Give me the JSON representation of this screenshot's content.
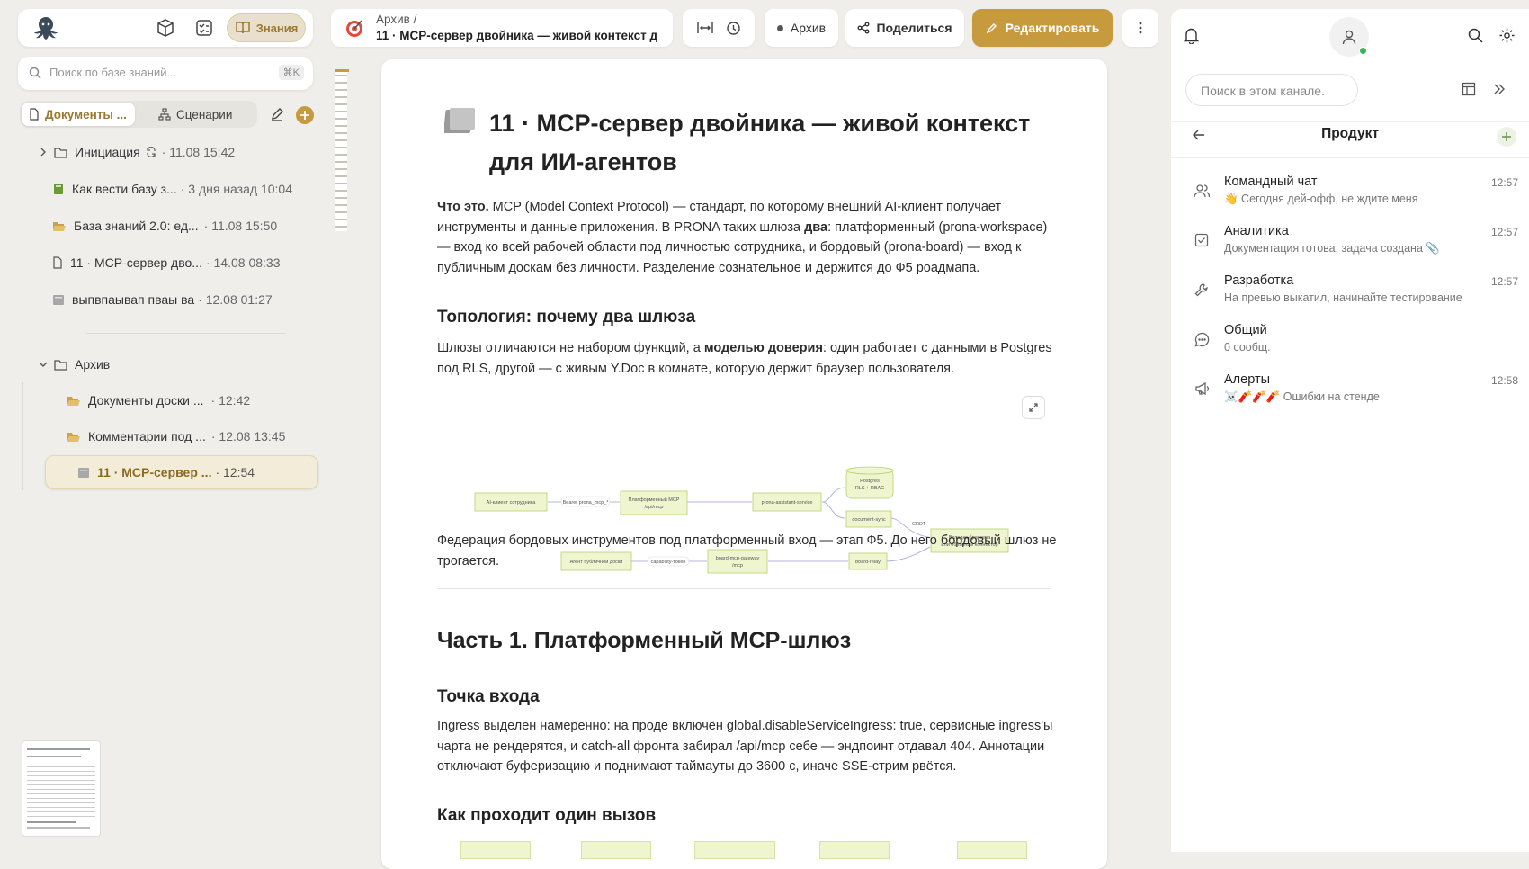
{
  "left": {
    "nav_active": "Знания",
    "search_placeholder": "Поиск по базе знаний...",
    "search_shortcut": "⌘K",
    "tab_docs": "Документы ...",
    "tab_scenarios": "Сценарии",
    "tree": [
      {
        "label": "Инициация",
        "meta": "· 11.08 15:42"
      },
      {
        "label": "Как вести базу з...",
        "meta": "· 3 дня назад 10:04"
      },
      {
        "label": "База знаний 2.0: ед...",
        "meta": "· 11.08 15:50"
      },
      {
        "label": "11 · MCP-сервер дво...",
        "meta": "· 14.08 08:33"
      },
      {
        "label": "выпвпаывап пваы ва",
        "meta": "· 12.08 01:27"
      },
      {
        "label": "Архив",
        "meta": ""
      },
      {
        "label": "Документы доски ...",
        "meta": "· 12:42"
      },
      {
        "label": "Комментарии под ...",
        "meta": "· 12.08 13:45"
      },
      {
        "label": "11 · MCP-сервер ...",
        "meta": "· 12:54"
      }
    ]
  },
  "top": {
    "breadcrumb_parent": "Архив",
    "breadcrumb_sep": "/",
    "breadcrumb_title": "11 · MCP-сервер двойника — живой контекст д",
    "status_label": "Архив",
    "share_label": "Поделиться",
    "edit_label": "Редактировать",
    "accent": "#c79a3e"
  },
  "doc": {
    "title_line1": "11 · MCP-сервер двойника — живой контекст",
    "title_line2": "для ИИ-агентов",
    "intro_bold": "Что это.",
    "intro_a": " MCP (Model Context Protocol) — стандарт, по которому внешний AI-клиент получает инструменты и данные приложения. В PRONA таких шлюза ",
    "intro_b": "два",
    "intro_c": ": платформенный (prona-workspace) — вход ко всей рабочей области под личностью сотрудника, и бордовый (prona-board) — вход к публичным доскам без личности. Разделение сознательное и держится до Ф5 роадмапа.",
    "h_topology": "Топология: почему два шлюза",
    "topo_a": "Шлюзы отличаются не набором функций, а ",
    "topo_b": "моделью доверия",
    "topo_c": ": один работает с данными в Postgres под RLS, другой — с живым Y.Doc в комнате, которую держит браузер пользователя.",
    "diagram": {
      "n_ai": "AI-клиент сотрудника",
      "e_bearer": "Bearer prona_mcp_*",
      "n_platform_1": "Платформенный MCP",
      "n_platform_2": "/api/mcp",
      "n_assistant": "prona-assistant-service",
      "n_pg_1": "Postgres",
      "n_pg_2": "RLS + RBAC",
      "n_docsync": "document-sync",
      "e_crdt": "CRDT",
      "n_tab_1": "Вкладка браузера",
      "n_tab_2": "или облачный коннектор",
      "n_pubagent": "Агент публичной доски",
      "e_cap": "capability-токен",
      "n_gateway_1": "board-mcp-gateway",
      "n_gateway_2": "/mcp",
      "n_relay": "board-relay"
    },
    "federation": "Федерация бордовых инструментов под платформенный вход — этап Ф5. До него бордовый шлюз не трогается.",
    "h_part1": "Часть 1. Платформенный MCP-шлюз",
    "h_entry": "Точка входа",
    "entry_text": "Ingress выделен намеренно: на проде включён global.disableServiceIngress: true, сервисные ingress'ы чарта не рендерятся, и catch-all фронта забирал /api/mcp себе — эндпоинт отдавал 404. Аннотации отключают буферизацию и поднимают таймауты до 3600 с, иначе SSE-стрим рвётся.",
    "h_call": "Как проходит один вызов"
  },
  "right": {
    "search_placeholder": "Поиск в этом канале.",
    "title": "Продукт",
    "channels": [
      {
        "name": "Командный чат",
        "preview": "👋 Сегодня дей-офф, не ждите меня",
        "time": "12:57",
        "icon": "users-icon"
      },
      {
        "name": "Аналитика",
        "preview": "Документация готова, задача создана 📎",
        "time": "12:57",
        "icon": "checkbox-icon"
      },
      {
        "name": "Разработка",
        "preview": "На превью выкатил, начинайте тестирование",
        "time": "12:57",
        "icon": "wrench-icon"
      },
      {
        "name": "Общий",
        "preview": "0 сообщ.",
        "time": "",
        "icon": "chat-icon"
      },
      {
        "name": "Алерты",
        "preview": "☠️🧨🧨🧨 Ошибки на стенде",
        "time": "12:58",
        "icon": "megaphone-icon"
      }
    ]
  }
}
